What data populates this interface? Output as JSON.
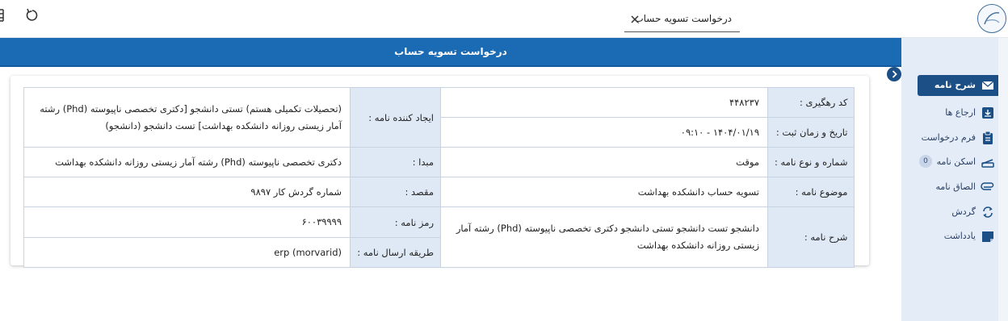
{
  "tab": {
    "label": "درخواست تسویه حساب"
  },
  "header": {
    "title": "درخواست تسویه حساب"
  },
  "sidebar": {
    "items": [
      {
        "label": "شرح نامه",
        "icon": "envelope-icon",
        "active": true
      },
      {
        "label": "ارجاع ها",
        "icon": "inbox-in-icon"
      },
      {
        "label": "فرم درخواست",
        "icon": "clipboard-icon"
      },
      {
        "label": "اسکن نامه",
        "icon": "scanner-icon",
        "badge": "0"
      },
      {
        "label": "الصاق نامه",
        "icon": "paperclip-icon"
      },
      {
        "label": "گردش",
        "icon": "cycle-icon"
      },
      {
        "label": "یادداشت",
        "icon": "note-icon"
      }
    ]
  },
  "details": {
    "left": [
      {
        "label": "کد رهگیری :",
        "value": "۴۴۸۲۳۷"
      },
      {
        "label": "تاریخ و زمان ثبت :",
        "value": "۱۴۰۴/۰۱/۱۹ - ۰۹:۱۰"
      },
      {
        "label": "شماره و نوع نامه :",
        "value": "موقت"
      },
      {
        "label": "موضوع نامه :",
        "value": "تسویه حساب دانشکده بهداشت"
      },
      {
        "label": "شرح نامه :",
        "value": "دانشجو تست دانشجو تستی دانشجو دکتری تخصصی ناپیوسته (Phd) رشته آمار زیستی روزانه دانشکده بهداشت"
      }
    ],
    "right": [
      {
        "label": "ایجاد کننده نامه :",
        "value": "(تحصیلات تکمیلی هستم) تستی دانشجو [دکتری تخصصی ناپیوسته (Phd) رشته آمار زیستی روزانه دانشکده بهداشت] تست دانشجو (دانشجو)"
      },
      {
        "label": "مبدا :",
        "value": "دکتری تخصصی ناپیوسته (Phd) رشته آمار زیستی روزانه دانشکده بهداشت"
      },
      {
        "label": "مقصد :",
        "value": "شماره گردش کار ۹۸۹۷"
      },
      {
        "label": "رمز نامه :",
        "value": "۶۰۰۳۹۹۹۹"
      },
      {
        "label": "طریقه ارسال نامه :",
        "value": "erp (morvarid)"
      }
    ]
  },
  "colors": {
    "primary": "#1b6ab4",
    "sidebar_bg": "#e3ecf7",
    "label_cell": "#dfe9f6",
    "label_text": "#2a3c8f"
  }
}
